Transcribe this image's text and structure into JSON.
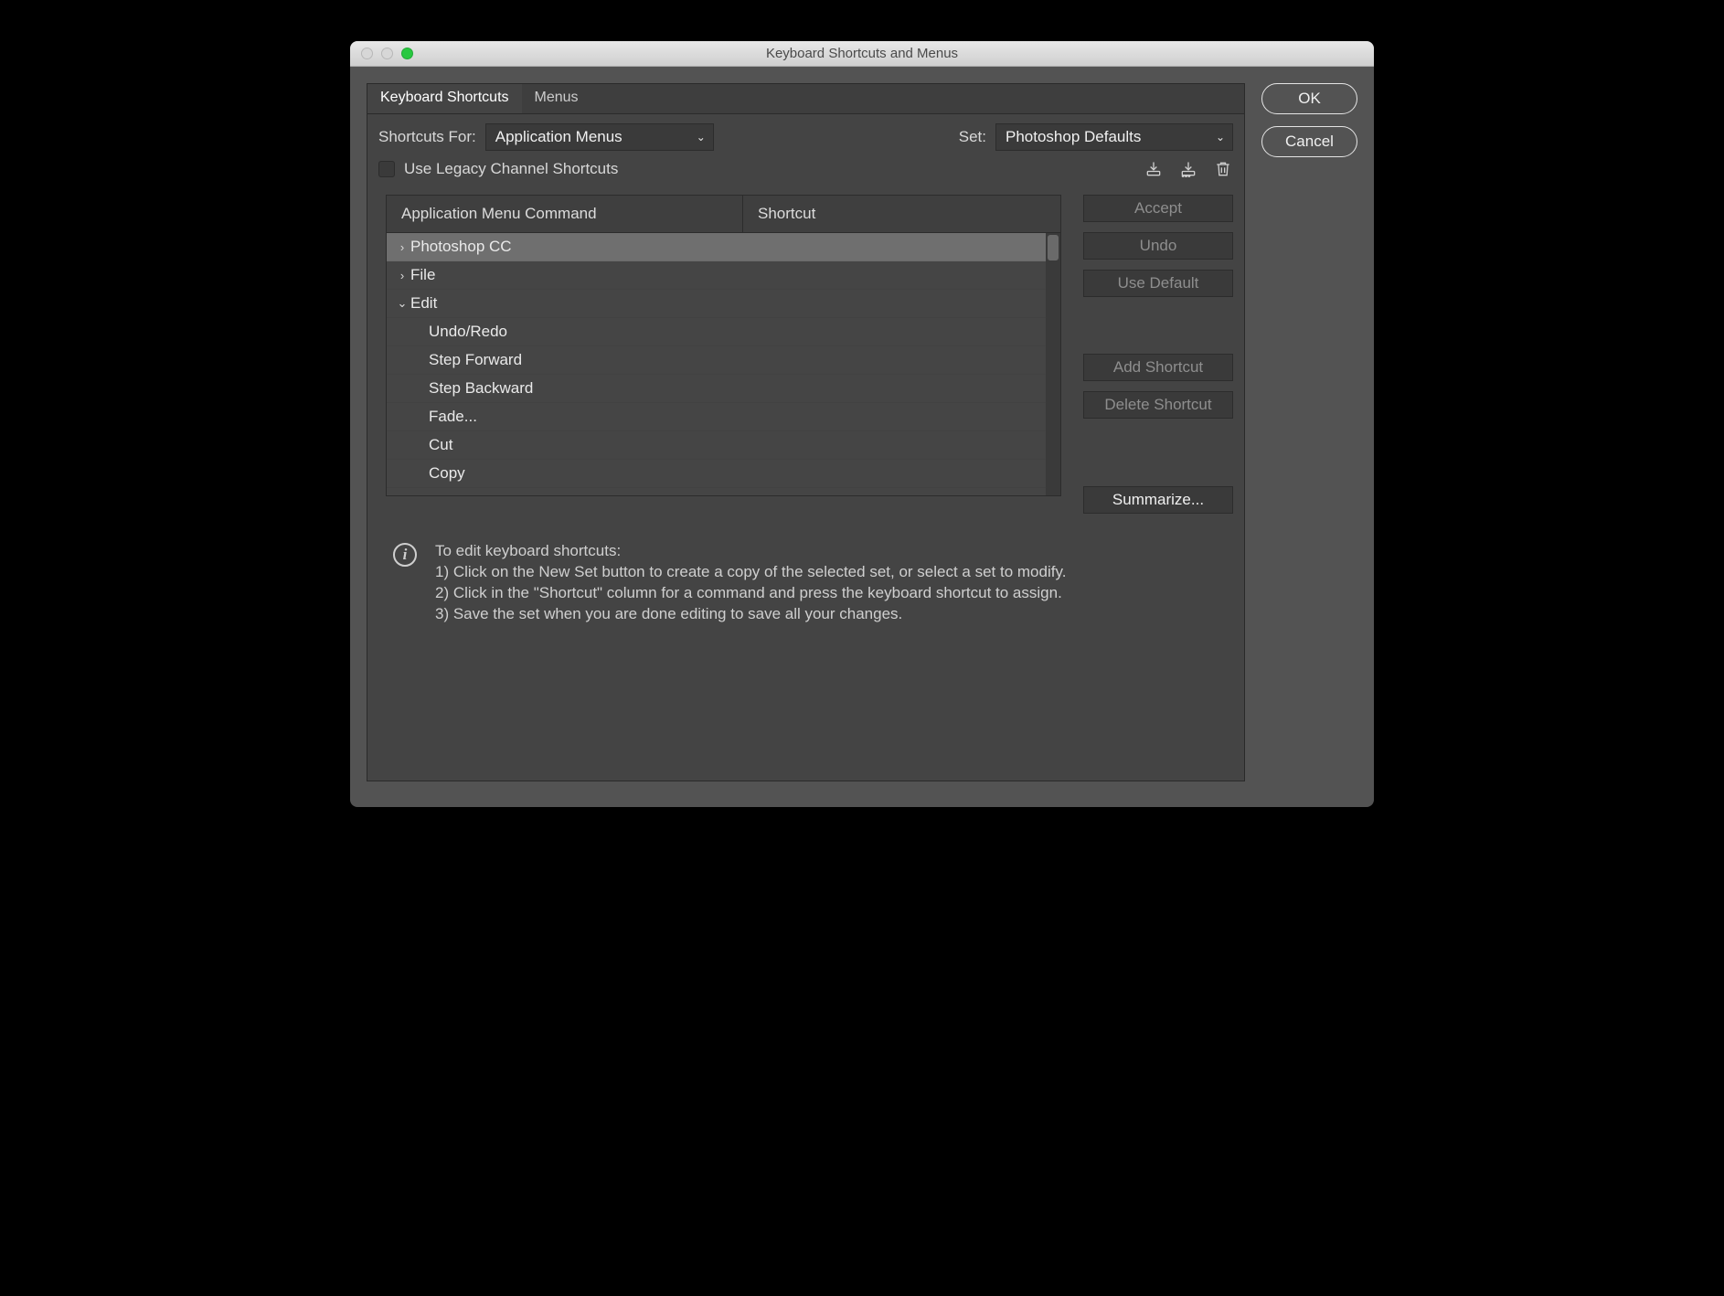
{
  "window": {
    "title": "Keyboard Shortcuts and Menus"
  },
  "tabs": {
    "shortcuts": "Keyboard Shortcuts",
    "menus": "Menus"
  },
  "shortcuts_for": {
    "label": "Shortcuts For:",
    "value": "Application Menus"
  },
  "set": {
    "label": "Set:",
    "value": "Photoshop Defaults"
  },
  "legacy": {
    "label": "Use Legacy Channel Shortcuts"
  },
  "columns": {
    "cmd": "Application Menu Command",
    "shortcut": "Shortcut"
  },
  "rows": {
    "r0": "Photoshop CC",
    "r1": "File",
    "r2": "Edit",
    "r3": "Undo/Redo",
    "r4": "Step Forward",
    "r5": "Step Backward",
    "r6": "Fade...",
    "r7": "Cut",
    "r8": "Copy"
  },
  "side": {
    "accept": "Accept",
    "undo": "Undo",
    "use_default": "Use Default",
    "add": "Add Shortcut",
    "delete": "Delete Shortcut",
    "summarize": "Summarize..."
  },
  "right": {
    "ok": "OK",
    "cancel": "Cancel"
  },
  "info": {
    "heading": "To edit keyboard shortcuts:",
    "l1": "1) Click on the New Set button to create a copy of the selected set, or select a set to modify.",
    "l2": "2) Click in the \"Shortcut\" column for a command and press the keyboard shortcut to assign.",
    "l3": "3) Save the set when you are done editing to save all your changes."
  }
}
